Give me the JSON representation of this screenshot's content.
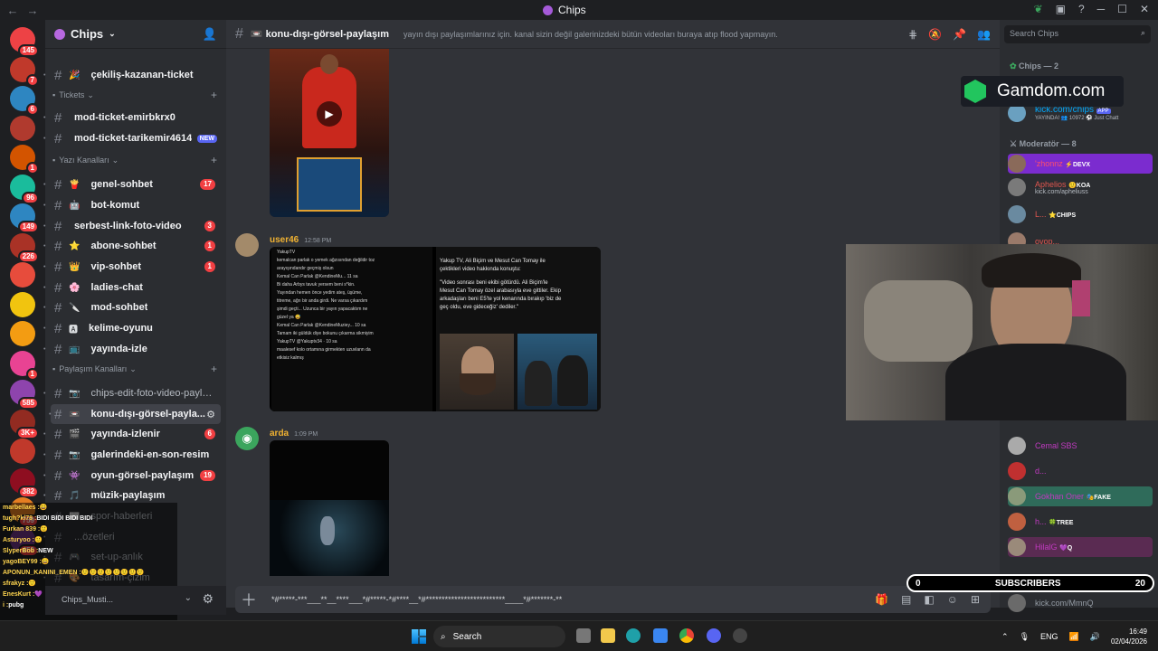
{
  "window": {
    "title": "Chips"
  },
  "server": {
    "name": "Chips"
  },
  "sidebar": {
    "channels": [
      {
        "name": "çekiliş-kazanan-ticket",
        "emoji": "🎉",
        "badge": "",
        "bright": true
      },
      {
        "name": "mod-ticket-emirbkrx0",
        "emoji": "",
        "badge": "",
        "bright": true
      },
      {
        "name": "mod-ticket-tarikemir4614",
        "emoji": "",
        "badge": "NEW",
        "bright": true
      },
      {
        "name": "genel-sohbet",
        "emoji": "🍟",
        "badge": "17",
        "bright": true
      },
      {
        "name": "bot-komut",
        "emoji": "🤖",
        "badge": "",
        "bright": true
      },
      {
        "name": "serbest-link-foto-video",
        "emoji": "",
        "badge": "3",
        "bright": true
      },
      {
        "name": "abone-sohbet",
        "emoji": "⭐",
        "badge": "1",
        "bright": true
      },
      {
        "name": "vip-sohbet",
        "emoji": "👑",
        "badge": "1",
        "bright": true
      },
      {
        "name": "ladies-chat",
        "emoji": "🌸",
        "badge": "",
        "bright": true
      },
      {
        "name": "mod-sohbet",
        "emoji": "🔪",
        "badge": "",
        "bright": true
      },
      {
        "name": "kelime-oyunu",
        "emoji": "🅰",
        "badge": "",
        "bright": true
      },
      {
        "name": "yayında-izle",
        "emoji": "📺",
        "badge": "",
        "bright": true
      },
      {
        "name": "chips-edit-foto-video-paylaş...",
        "emoji": "📷",
        "badge": "",
        "bright": false
      },
      {
        "name": "konu-dışı-görsel-payla...",
        "emoji": "📼",
        "badge": "",
        "bright": true
      },
      {
        "name": "yayında-izlenir",
        "emoji": "🎬",
        "badge": "6",
        "bright": true
      },
      {
        "name": "galerindeki-en-son-resim",
        "emoji": "📷",
        "badge": "",
        "bright": true
      },
      {
        "name": "oyun-görsel-paylaşım",
        "emoji": "👾",
        "badge": "19",
        "bright": true
      },
      {
        "name": "müzik-paylaşım",
        "emoji": "🎵",
        "badge": "",
        "bright": true
      },
      {
        "name": "spor-haberleri",
        "emoji": "📰",
        "badge": "",
        "bright": false
      },
      {
        "name": "...özetleri",
        "emoji": "",
        "badge": "",
        "bright": false
      },
      {
        "name": "set-up-anlık",
        "emoji": "🎮",
        "badge": "",
        "bright": false
      },
      {
        "name": "tasarım-çizim",
        "emoji": "🎨",
        "badge": "",
        "bright": false
      }
    ],
    "categories": [
      "Tickets",
      "Yazı Kanalları",
      "Paylaşım Kanalları"
    ],
    "guild_badges": [
      "145",
      "7",
      "6",
      "",
      "1",
      "96",
      "149",
      "226",
      "",
      "",
      "",
      "1",
      "585",
      "3K+",
      "",
      "382",
      "759",
      "450"
    ]
  },
  "channel": {
    "name": "konu-dışı-görsel-paylaşım",
    "emoji": "📼",
    "topic": "yayın dışı paylaşımlarınız için. kanal sizin değil galerinizdeki bütün videoları buraya atıp flood yapmayın."
  },
  "messages": [
    {
      "author": "user46",
      "time": "12:58 PM",
      "color": "#f0b232"
    },
    {
      "author": "arda",
      "time": "1:09 PM",
      "color": "#f0b232"
    }
  ],
  "tweet": {
    "left_lines": [
      "YakupTV",
      "kemalcan parlak o yemek ağzısından değildir toz",
      "arayışındandır geçmiş olsun",
      "Kemal Can Parlak @KendineMu... 11 sa",
      "Bi daha Arbys tavuk yersem beni s*kin.",
      "Yayından hemen önce yedim ateş, üşüme,",
      "titreme, ağrı bir anda girdi. Ne varsa çıkardım",
      "şimdi geçti... Uzunca bir yayın yapacaktım ne",
      "güzel ya 😅",
      "Kemal Can Parlak @KendineMuziey... 10 sa",
      "Tamam iki güldük diye bokunu çıkarma sikmiyim",
      "YakupTV @Yakuptv34 · 10 sa",
      "maalesef kolo ortamına girmekten uzuvlann da",
      "etkisiz kalmış"
    ],
    "right_lines": [
      "Yakup TV, Ali Biçim ve Mesut Can Tomay ile",
      "çektikleri video hakkında konuştu:",
      "\"Video sonrası beni ekibi götürdü. Ali Biçim'le",
      "Mesut Can Tomay özel arabasıyla eve gittiler. Ekip",
      "arkadaşları beni E5'te yol kenarında bırakıp 'biz de",
      "geç oldu, eve gideceğiz' dediler.\""
    ]
  },
  "composer": {
    "text": "*#*****-***___**__****___*#*****-*#****__*#*************************____*#*******-**"
  },
  "search": {
    "placeholder": "Search Chips"
  },
  "members": {
    "chips_header": "Chips — 2",
    "mod_header": "Moderatör — 8",
    "kick_link": "kick.com/chips",
    "kick_tag": "APP",
    "kick_sub": "YAYINDA! 👥 10972 ⚽ Just Chatt",
    "list": [
      {
        "name": "'zhonnz",
        "tag": "⚡DEVX",
        "color": "#ff4d6d",
        "bg": "#7b2ccf"
      },
      {
        "name": "Aphelios",
        "sub": "kick.com/apheliuss",
        "tag": "🙂KOA",
        "color": "#e0564f",
        "bg": ""
      },
      {
        "name": "L...",
        "tag": "⭐CHIPS",
        "color": "#e0564f",
        "bg": ""
      },
      {
        "name": "ovop...",
        "tag": "",
        "color": "#e0564f",
        "bg": ""
      },
      {
        "name": "Cemal SBS",
        "tag": "",
        "color": "#c03ac0",
        "bg": ""
      },
      {
        "name": "d...",
        "tag": "",
        "color": "#c03ac0",
        "bg": ""
      },
      {
        "name": "Gokhan Oner",
        "tag": "🎭FAKE",
        "color": "#c03ac0",
        "bg": "#2f6b5a"
      },
      {
        "name": "h...",
        "tag": "🍀TREE",
        "color": "#c03ac0",
        "bg": ""
      },
      {
        "name": "HilalG",
        "tag": "💜Q",
        "color": "#c03ac0",
        "bg": "#5a2b52"
      },
      {
        "name": "kick.com/MmnQ",
        "tag": "",
        "color": "#949ba4",
        "bg": ""
      }
    ]
  },
  "stream": {
    "gamdom": "Gamdom.com",
    "subs_label": "SUBSCRIBERS",
    "subs_left": "0",
    "subs_count": "20"
  },
  "chat_overlay": [
    {
      "user": "marbellaes :",
      "msg": "😀"
    },
    {
      "user": "tugh?kl78 :",
      "msg": "BIDI BIDI BIDI BIDI"
    },
    {
      "user": "Furkan 839 :",
      "msg": "🙂"
    },
    {
      "user": "Asturyoo :",
      "msg": "🙂"
    },
    {
      "user": "SlyperBob :",
      "msg": "NEW"
    },
    {
      "user": "yagoBEY99 :",
      "msg": "😄"
    },
    {
      "user": "APONUN_KANINI_EMEN :",
      "msg": "🙂🙂🙂🙂🙂🙂🙂🙂"
    },
    {
      "user": "sfrakyz :",
      "msg": "🙂"
    },
    {
      "user": "EnesKurt :",
      "msg": "💜"
    },
    {
      "user": "i :",
      "msg": "pubg"
    }
  ],
  "user_panel": {
    "name": "Chips_Musti..."
  },
  "taskbar": {
    "search": "Search",
    "lang": "ENG",
    "time": "16:49",
    "date": "02/04/2026"
  }
}
